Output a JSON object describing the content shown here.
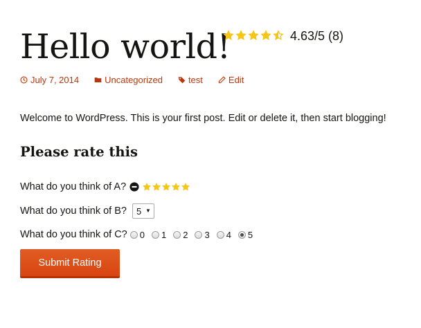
{
  "post": {
    "title": "Hello world!",
    "avg_rating": {
      "value": 4.63,
      "max": 5,
      "count": 8,
      "text": "4.63/5 (8)"
    },
    "meta": {
      "date": "July 7, 2014",
      "category": "Uncategorized",
      "tag": "test",
      "edit": "Edit"
    },
    "intro": "Welcome to WordPress. This is your first post. Edit or delete it, then start blogging!"
  },
  "rating_form": {
    "heading": "Please rate this",
    "question_a": {
      "label": "What do you think of A?",
      "stars": 5,
      "max": 5
    },
    "question_b": {
      "label": "What do you think of B?",
      "selected": "5"
    },
    "question_c": {
      "label": "What do you think of C?",
      "options": [
        "0",
        "1",
        "2",
        "3",
        "4",
        "5"
      ],
      "selected": "5"
    },
    "submit_label": "Submit Rating"
  },
  "colors": {
    "star": "#f5c518",
    "link": "#bc360a",
    "button": "#d94412",
    "text": "#141412"
  },
  "icons": {
    "date": "clock-icon",
    "category": "folder-icon",
    "tag": "tag-icon",
    "edit": "pencil-icon",
    "clear": "no-rating-icon",
    "rating": "star-icon"
  }
}
